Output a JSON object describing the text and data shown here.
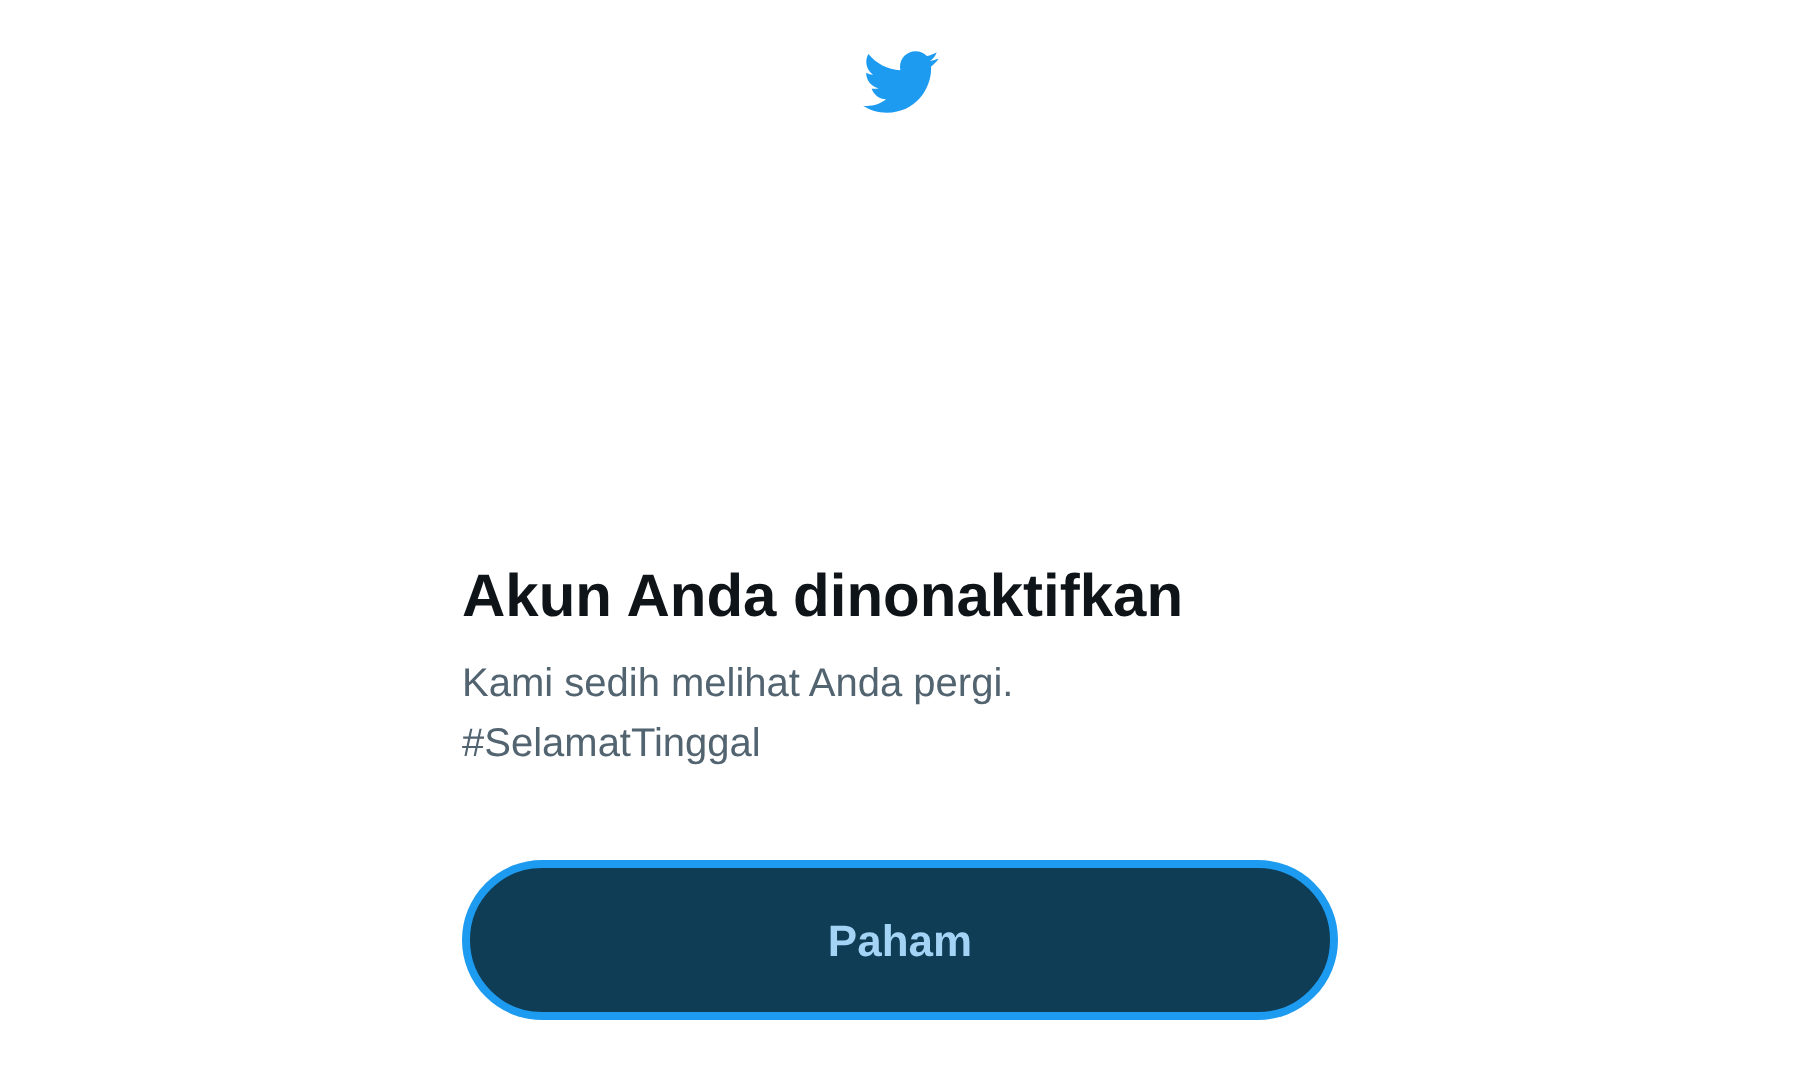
{
  "title": "Akun Anda dinonaktifkan",
  "message": "Kami sedih melihat Anda pergi. #SelamatTinggal",
  "button": {
    "label": "Paham",
    "focused": true
  }
}
